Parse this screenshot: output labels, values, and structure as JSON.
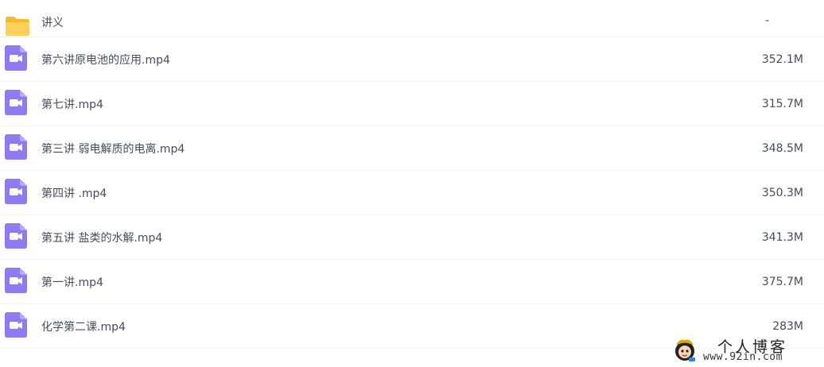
{
  "files": [
    {
      "type": "folder",
      "icon": "folder-icon",
      "name": "讲义",
      "size": "-"
    },
    {
      "type": "video",
      "icon": "video-file-icon",
      "name": "第六讲原电池的应用.mp4",
      "size": "352.1M"
    },
    {
      "type": "video",
      "icon": "video-file-icon",
      "name": "第七讲.mp4",
      "size": "315.7M"
    },
    {
      "type": "video",
      "icon": "video-file-icon",
      "name": "第三讲 弱电解质的电离.mp4",
      "size": "348.5M"
    },
    {
      "type": "video",
      "icon": "video-file-icon",
      "name": "第四讲 .mp4",
      "size": "350.3M"
    },
    {
      "type": "video",
      "icon": "video-file-icon",
      "name": "第五讲 盐类的水解.mp4",
      "size": "341.3M"
    },
    {
      "type": "video",
      "icon": "video-file-icon",
      "name": "第一讲.mp4",
      "size": "375.7M"
    },
    {
      "type": "video",
      "icon": "video-file-icon",
      "name": "化学第二课.mp4",
      "size": "283M"
    }
  ],
  "watermark": {
    "title": "个人博客",
    "url": "www.92in.com"
  },
  "colors": {
    "folder": "#ffc94d",
    "video": "#8c7cf0",
    "text": "#454d5a",
    "divider": "#f1f2f4"
  }
}
